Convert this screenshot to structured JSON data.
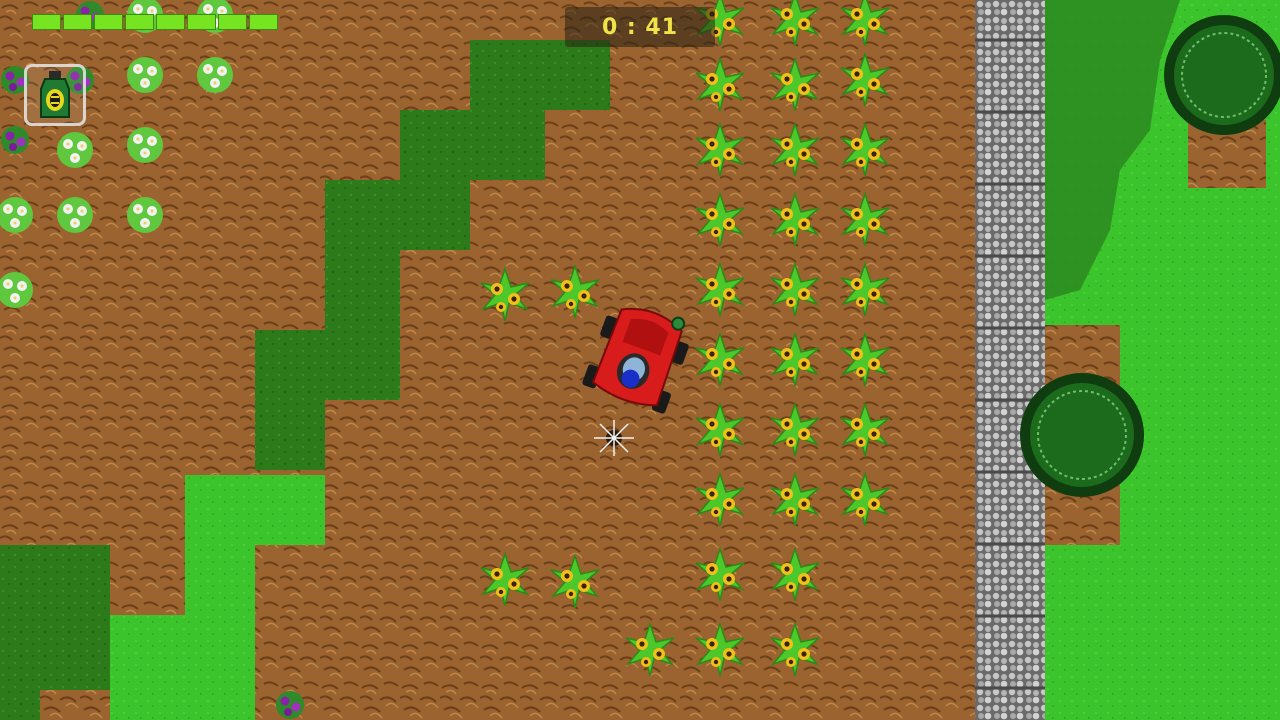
{
  "hud": {
    "timer": "0 : 41",
    "health_fraction": 1.0,
    "item_icon": "fertilizer-bottle-icon"
  },
  "colors": {
    "cut_grass": "#2d7a1a",
    "bright_lawn": "#37c02a",
    "tall_grass": "#8b5a2b",
    "stone_path": "#b0b0b0",
    "mower_red": "#d81c1c",
    "sunflower_yellow": "#f2c01a",
    "health_green": "#76e421",
    "timer_text": "#f0e34a"
  }
}
